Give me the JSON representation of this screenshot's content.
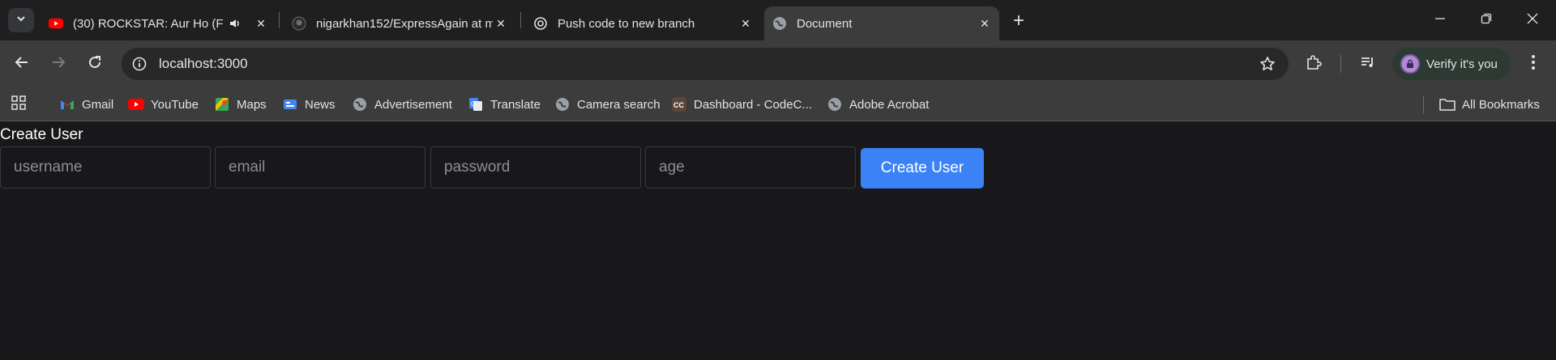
{
  "tabs": [
    {
      "title": "(30) ROCKSTAR: Aur Ho (Full",
      "icon": "youtube-icon",
      "audio": true
    },
    {
      "title": "nigarkhan152/ExpressAgain at m",
      "icon": "github-icon"
    },
    {
      "title": "Push code to new branch",
      "icon": "chatgpt-icon"
    },
    {
      "title": "Document",
      "icon": "globe-icon",
      "active": true
    }
  ],
  "address_bar": {
    "url": "localhost:3000"
  },
  "profile": {
    "label": "Verify it's you"
  },
  "bookmarks": [
    {
      "label": "Gmail",
      "icon": "gmail-icon"
    },
    {
      "label": "YouTube",
      "icon": "youtube-icon"
    },
    {
      "label": "Maps",
      "icon": "maps-icon"
    },
    {
      "label": "News",
      "icon": "news-icon"
    },
    {
      "label": "Advertisement",
      "icon": "globe-icon"
    },
    {
      "label": "Translate",
      "icon": "translate-icon"
    },
    {
      "label": "Camera search",
      "icon": "globe-icon"
    },
    {
      "label": "Dashboard - CodeC...",
      "icon": "codechef-icon"
    },
    {
      "label": "Adobe Acrobat",
      "icon": "globe-icon"
    }
  ],
  "all_bookmarks": {
    "label": "All Bookmarks"
  },
  "page": {
    "heading": "Create User",
    "fields": {
      "username": {
        "placeholder": "username",
        "value": ""
      },
      "email": {
        "placeholder": "email",
        "value": ""
      },
      "password": {
        "placeholder": "password",
        "value": ""
      },
      "age": {
        "placeholder": "age",
        "value": ""
      }
    },
    "submit_label": "Create User"
  },
  "colors": {
    "accent": "#3b82f6",
    "page_bg": "#18181b",
    "chrome_bg": "#3c3c3c"
  }
}
